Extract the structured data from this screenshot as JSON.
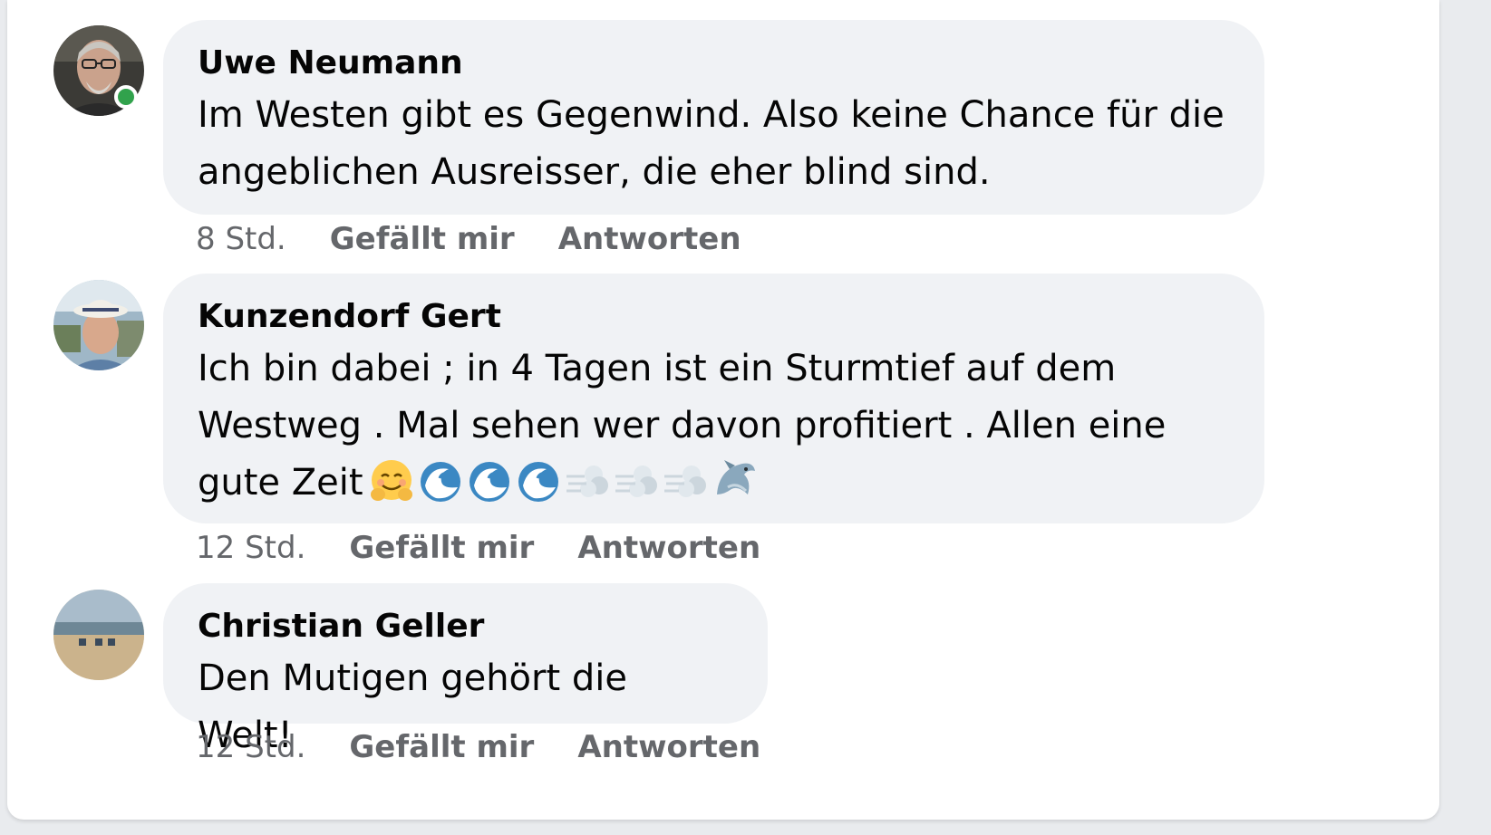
{
  "comments": [
    {
      "author": "Uwe Neumann",
      "text": "Im Westen gibt es Gegenwind. Also keine Chance für die angeblichen Ausreisser, die eher blind sind.",
      "time": "8 Std.",
      "like_label": "Gefällt mir",
      "reply_label": "Antworten",
      "online": true
    },
    {
      "author": "Kunzendorf Gert",
      "text": "Ich bin dabei ; in 4 Tagen ist ein Sturmtief auf dem Westweg . Mal sehen wer davon profitiert . Allen eine gute Zeit",
      "emojis": [
        "hugging-face-emoji",
        "wave-emoji",
        "wave-emoji",
        "wave-emoji",
        "wind-emoji",
        "wind-emoji",
        "wind-emoji",
        "dolphin-emoji"
      ],
      "time": "12 Std.",
      "like_label": "Gefällt mir",
      "reply_label": "Antworten",
      "online": false
    },
    {
      "author": "Christian Geller",
      "text": "Den Mutigen gehört die Welt!",
      "time": "12 Std.",
      "like_label": "Gefällt mir",
      "reply_label": "Antworten",
      "online": false
    }
  ],
  "colors": {
    "bubble": "#f0f2f5",
    "meta_text": "#65676b",
    "online": "#31a24c"
  }
}
